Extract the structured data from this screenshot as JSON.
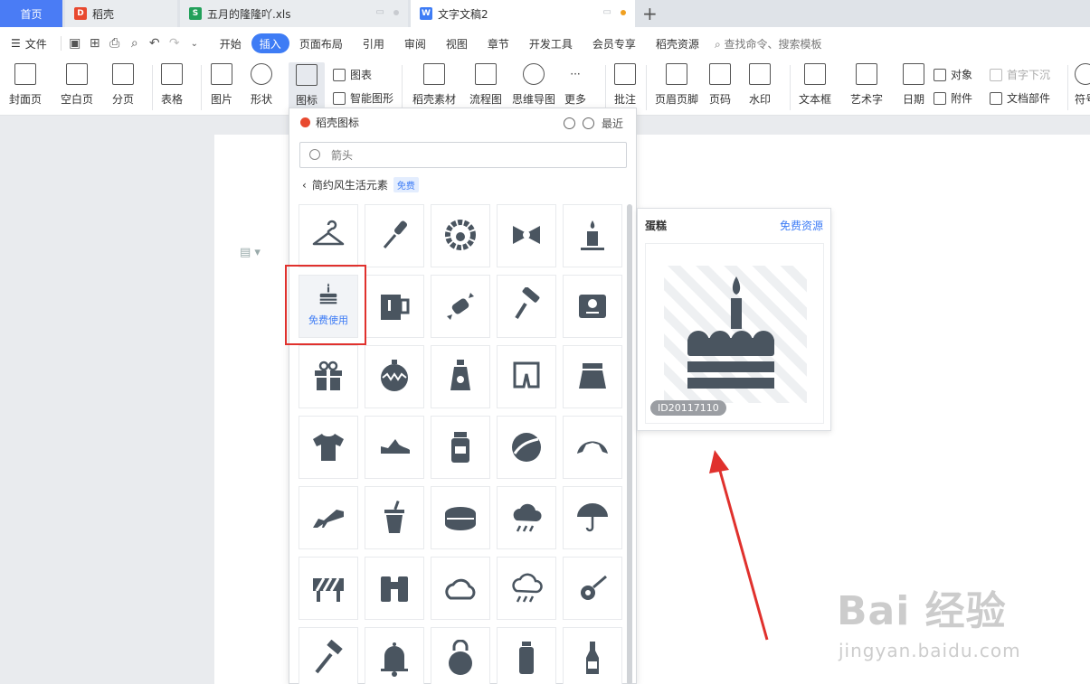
{
  "tabs": [
    {
      "label": "首页"
    },
    {
      "label": "稻壳"
    },
    {
      "label": "五月的隆隆吖.xls"
    },
    {
      "label": "文字文稿2"
    }
  ],
  "menu": {
    "file": "文件",
    "items": [
      "开始",
      "插入",
      "页面布局",
      "引用",
      "审阅",
      "视图",
      "章节",
      "开发工具",
      "会员专享",
      "稻壳资源"
    ],
    "search": "查找命令、搜索模板"
  },
  "ribbon": {
    "cover": "封面页",
    "blank": "空白页",
    "pagebreak": "分页",
    "table": "表格",
    "picture": "图片",
    "shape": "形状",
    "icon": "图标",
    "chart": "图表",
    "smartshape": "智能图形",
    "daoke_material": "稻壳素材",
    "flowchart": "流程图",
    "mindmap": "思维导图",
    "more": "更多",
    "comment": "批注",
    "header_footer": "页眉页脚",
    "page_number": "页码",
    "watermark": "水印",
    "textbox": "文本框",
    "wordart": "艺术字",
    "date": "日期",
    "object": "对象",
    "attachment": "附件",
    "dropcap": "首字下沉",
    "docparts": "文档部件",
    "symbol": "符号"
  },
  "panel": {
    "title": "稻壳图标",
    "recent": "最近",
    "search_placeholder": "箭头",
    "crumb": "简约风生活元素",
    "crumb_badge": "免费",
    "use_label": "免费使用",
    "icons": [
      "hanger-icon",
      "screwdriver-icon",
      "wreath-icon",
      "bow-icon",
      "candle-icon",
      "cake-icon",
      "mug-icon",
      "candy-icon",
      "paint-roller-icon",
      "scale-icon",
      "gift-icon",
      "ornament-icon",
      "sunscreen-icon",
      "shorts-icon",
      "skirt-icon",
      "tshirt-icon",
      "shoe-icon",
      "jar-icon",
      "ball-icon",
      "croissant-icon",
      "high-heel-icon",
      "cup-icon",
      "round-cake-icon",
      "rain-cloud-icon",
      "umbrella-icon",
      "barrier-icon",
      "binoculars-icon",
      "cloud-icon",
      "storm-cloud-icon",
      "location-pin-icon",
      "hammer-icon",
      "bell-icon",
      "kettlebell-icon",
      "bottle-icon",
      "wine-bottle-icon"
    ]
  },
  "preview": {
    "title": "蛋糕",
    "link": "免费资源",
    "id": "ID20117110"
  },
  "watermark": {
    "logo": "Bai 经验",
    "url": "jingyan.baidu.com"
  },
  "colors": {
    "accent": "#3e7cf5",
    "icon": "#4a5560",
    "highlight": "#e0312d"
  }
}
